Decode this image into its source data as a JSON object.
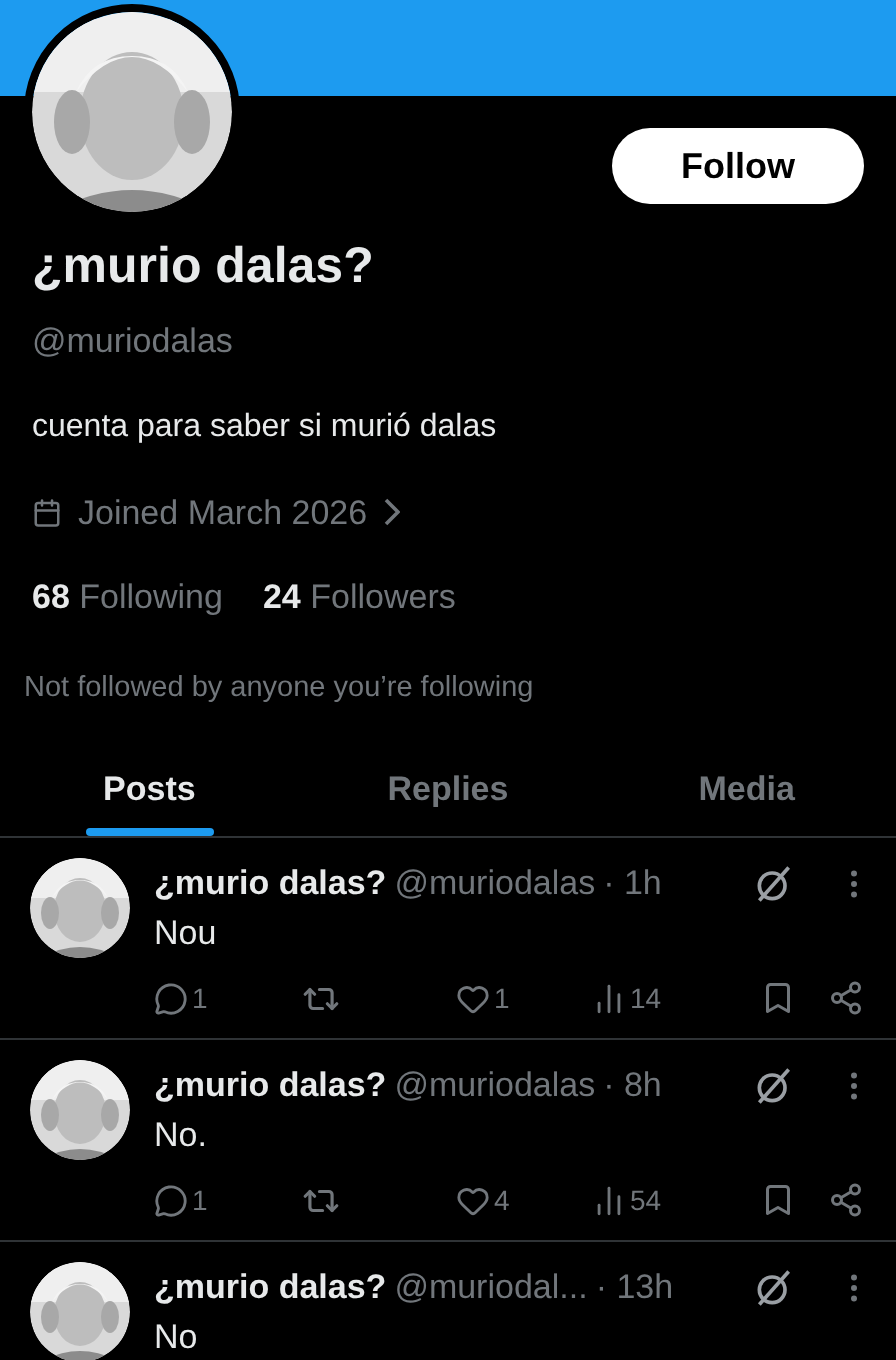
{
  "profile": {
    "follow_button": "Follow",
    "name": "¿murio dalas?",
    "handle": "@muriodalas",
    "bio": "cuenta para saber si murió dalas",
    "joined": "Joined March 2026",
    "following_count": "68",
    "following_label": "Following",
    "followers_count": "24",
    "followers_label": "Followers",
    "followed_by": "Not followed by anyone you’re following"
  },
  "tabs": [
    {
      "label": "Posts",
      "selected": true
    },
    {
      "label": "Replies",
      "selected": false
    },
    {
      "label": "Media",
      "selected": false
    }
  ],
  "posts": [
    {
      "name": "¿murio dalas?",
      "handle": "@muriodalas",
      "time": "· 1h",
      "text": "Nou",
      "actions": {
        "replies": "1",
        "likes": "1",
        "views": "14"
      }
    },
    {
      "name": "¿murio dalas?",
      "handle": "@muriodalas",
      "time": "· 8h",
      "text": "No.",
      "actions": {
        "replies": "1",
        "likes": "4",
        "views": "54"
      }
    },
    {
      "name": "¿murio dalas?",
      "handle": "@muriodal...",
      "time": "· 13h",
      "text": "No"
    }
  ]
}
